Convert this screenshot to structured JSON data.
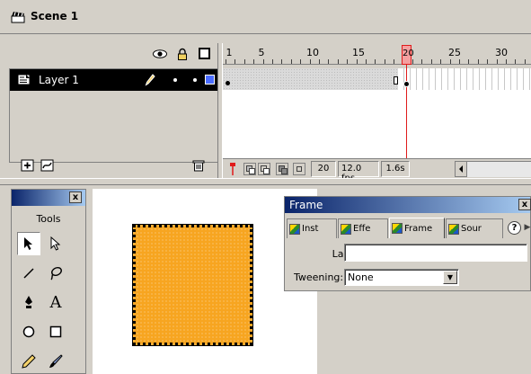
{
  "scene": {
    "title": "Scene 1",
    "icon": "clapper-icon"
  },
  "timeline": {
    "header_icons": [
      "eye-icon",
      "lock-icon",
      "outline-square-icon"
    ],
    "ruler_ticks": [
      "1",
      "5",
      "10",
      "15",
      "20",
      "25",
      "30"
    ],
    "layer": {
      "name": "Layer 1",
      "icon": "layer-page-icon",
      "edit_icon": "pencil-icon",
      "color": "#4a6cff"
    },
    "current_frame": "20",
    "frame_rate": "12.0 fps",
    "elapsed": "1.6s",
    "playhead_color": "#e01b1b",
    "bottom_icons": [
      "add-layer-icon",
      "add-motion-guide-icon",
      "trash-icon"
    ],
    "status_buttons": [
      "center-frame-icon",
      "onion-skin-icon",
      "onion-skin-outlines-icon",
      "edit-multiple-frames-icon",
      "modify-onion-markers-icon"
    ]
  },
  "tools_panel": {
    "close": "x",
    "label": "Tools",
    "tools": [
      {
        "name": "arrow-tool",
        "glyph": "➤"
      },
      {
        "name": "subselect-tool",
        "glyph": "↖"
      },
      {
        "name": "line-tool",
        "glyph": "╱"
      },
      {
        "name": "lasso-tool",
        "glyph": "♀"
      },
      {
        "name": "pen-tool",
        "glyph": "✒"
      },
      {
        "name": "text-tool",
        "glyph": "A"
      },
      {
        "name": "oval-tool",
        "glyph": "○"
      },
      {
        "name": "rectangle-tool",
        "glyph": "□"
      },
      {
        "name": "pencil-tool",
        "glyph": "✏"
      },
      {
        "name": "brush-tool",
        "glyph": "✎"
      }
    ]
  },
  "stage": {
    "shape_color": "#f7a520"
  },
  "frame_panel": {
    "title": "Frame",
    "close": "x",
    "tabs": [
      {
        "label": "Inst"
      },
      {
        "label": "Effe"
      },
      {
        "label": "Frame"
      },
      {
        "label": "Sour"
      }
    ],
    "help": "?",
    "label_caption": "Label:",
    "label_value": "",
    "tweening_caption": "Tweening:",
    "tweening_value": "None"
  }
}
